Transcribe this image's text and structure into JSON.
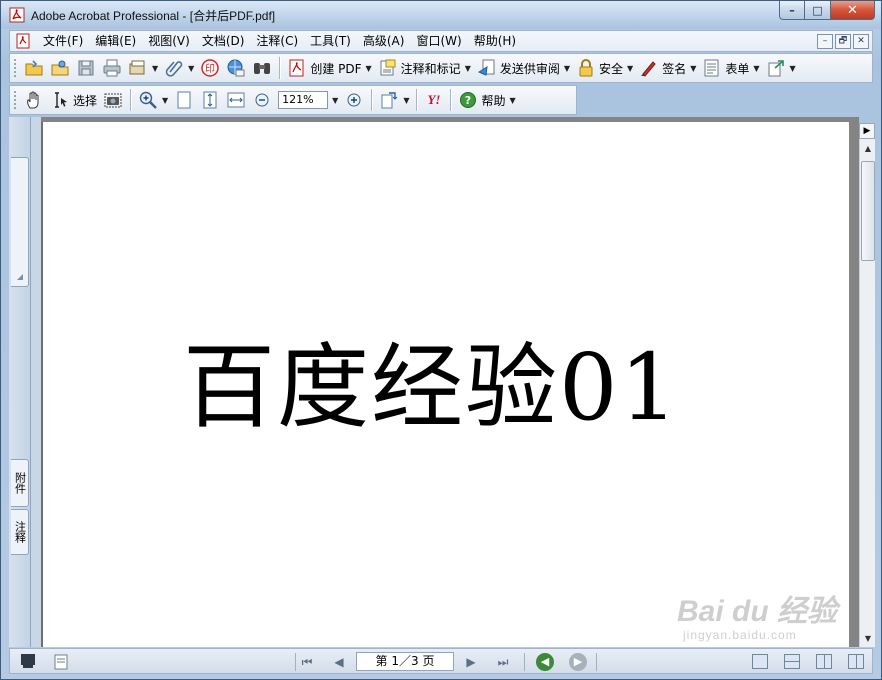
{
  "window": {
    "title": "Adobe Acrobat Professional - [合并后PDF.pdf]",
    "caption": {
      "minimize": "–",
      "maximize": "□",
      "close": "✕"
    }
  },
  "menu": {
    "items": [
      "文件(F)",
      "编辑(E)",
      "视图(V)",
      "文档(D)",
      "注释(C)",
      "工具(T)",
      "高级(A)",
      "窗口(W)",
      "帮助(H)"
    ],
    "mdi": {
      "minimize": "–",
      "restore": "🗗",
      "close": "✕"
    }
  },
  "toolbar1": {
    "create_pdf": "创建 PDF",
    "comment_markup": "注释和标记",
    "send_review": "发送供审阅",
    "security": "安全",
    "sign": "签名",
    "forms": "表单"
  },
  "toolbar2": {
    "select": "选择",
    "zoom_value": "121%",
    "help": "帮助",
    "yahoo": "Y!"
  },
  "side_tabs": {
    "attachments": "附件",
    "comments": "注释"
  },
  "document": {
    "text": "百度经验01"
  },
  "status": {
    "page_indicator": "第 1／3 页"
  },
  "watermark": {
    "brand": "Bai du 经验",
    "sub": "jingyan.baidu.com"
  },
  "colors": {
    "accent": "#3b5c80",
    "close_red": "#c13b20",
    "nav_green": "#3a8a3a"
  }
}
